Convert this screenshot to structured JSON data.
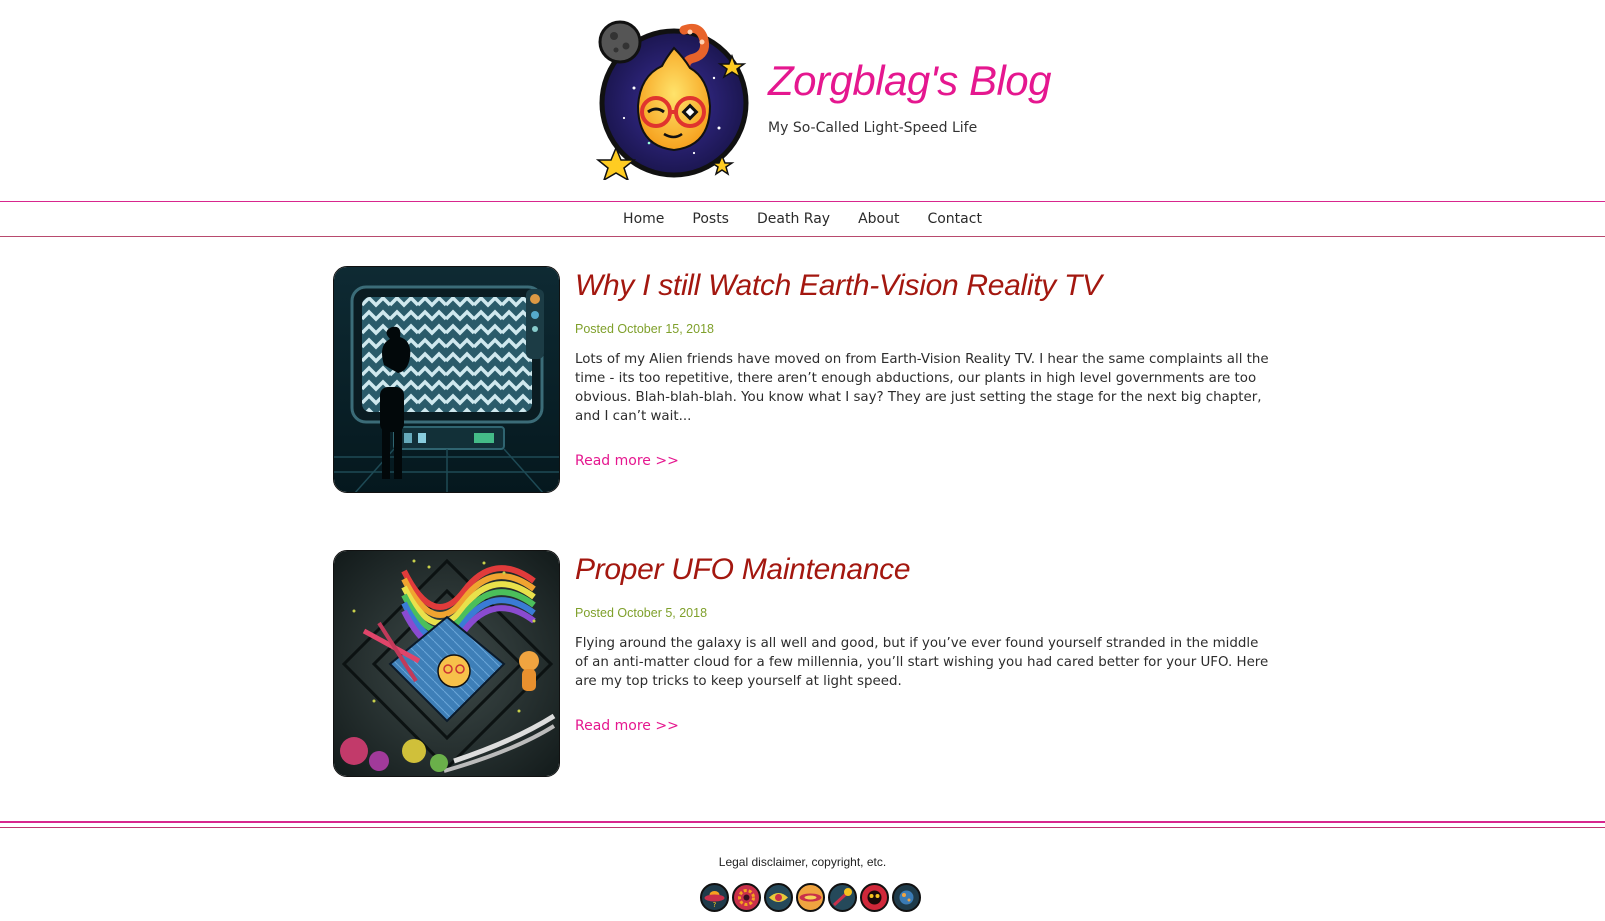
{
  "site": {
    "title": "Zorgblag's Blog",
    "tagline": "My So-Called Light-Speed Life",
    "logo_icon": "alien-mascot-logo-icon",
    "accent_color": "#e5178f",
    "title_color": "#a3170f",
    "date_color": "#7fa02b"
  },
  "nav": {
    "items": [
      {
        "label": "Home"
      },
      {
        "label": "Posts"
      },
      {
        "label": "Death Ray"
      },
      {
        "label": "About"
      },
      {
        "label": "Contact"
      }
    ]
  },
  "posts": [
    {
      "title": "Why I still Watch Earth-Vision Reality TV",
      "date": "Posted October 15, 2018",
      "excerpt": "Lots of my Alien friends have moved on from Earth-Vision Reality TV. I hear the same complaints all the time - its too repetitive, there aren’t enough abductions, our plants in high level governments are too obvious. Blah-blah-blah. You know what I say? They are just setting the stage for the next big chapter, and I can’t wait...",
      "read_more": "Read more >>",
      "thumbnail_icon": "alien-watching-tv-illustration"
    },
    {
      "title": "Proper UFO Maintenance",
      "date": "Posted October 5, 2018",
      "excerpt": "Flying around the galaxy is all well and good, but if you’ve ever found yourself stranded in the middle of an anti-matter cloud for a few millennia, you’ll start wishing you had cared better for your UFO. Here are my top tricks to keep yourself at light speed.",
      "read_more": "Read more >>",
      "thumbnail_icon": "ufo-maintenance-illustration"
    }
  ],
  "footer": {
    "text": "Legal disclaimer, copyright, etc.",
    "icons": [
      "ufo-icon",
      "gear-planet-icon",
      "eye-icon",
      "flying-saucer-icon",
      "comet-icon",
      "alien-face-icon",
      "planet-icon"
    ]
  }
}
